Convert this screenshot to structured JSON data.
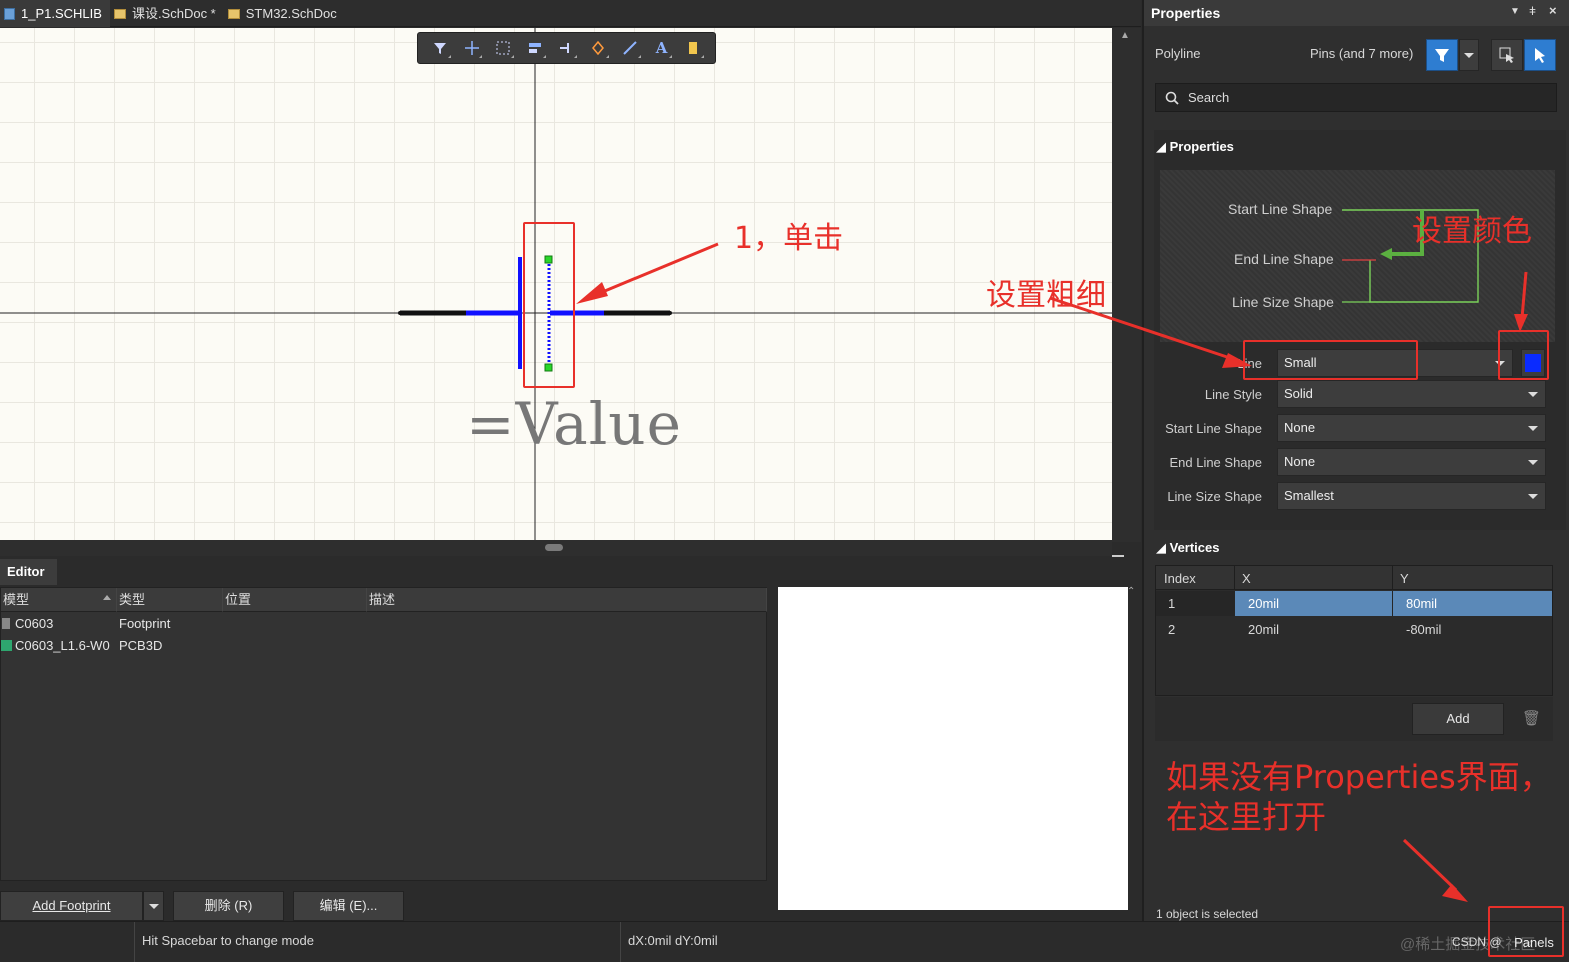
{
  "tabs": [
    {
      "label": "1_P1.SCHLIB",
      "icon": "schlib-icon",
      "active": true
    },
    {
      "label": "课设.SchDoc *",
      "icon": "schdoc-icon"
    },
    {
      "label": "STM32.SchDoc",
      "icon": "schdoc-icon"
    }
  ],
  "canvas": {
    "value_text": "=Value"
  },
  "editor": {
    "tab": "Editor",
    "columns": [
      "模型",
      "类型",
      "位置",
      "描述"
    ],
    "rows": [
      {
        "model": "C0603",
        "type": "Footprint",
        "location": "",
        "desc": ""
      },
      {
        "model": "C0603_L1.6-W0",
        "type": "PCB3D",
        "location": "",
        "desc": ""
      }
    ],
    "buttons": {
      "add_footprint": "Add Footprint",
      "delete": "删除 (R)",
      "edit": "编辑 (E)..."
    }
  },
  "status": {
    "hint": "Hit Spacebar to change mode",
    "delta": "dX:0mil dY:0mil"
  },
  "properties": {
    "title": "Properties",
    "object": "Polyline",
    "filter_summary": "Pins (and 7 more)",
    "search_placeholder": "Search",
    "section_properties": "Properties",
    "diagram_labels": [
      "Start Line Shape",
      "End Line Shape",
      "Line Size Shape"
    ],
    "fields": [
      {
        "label": "Line",
        "value": "Small"
      },
      {
        "label": "Line Style",
        "value": "Solid"
      },
      {
        "label": "Start Line Shape",
        "value": "None"
      },
      {
        "label": "End Line Shape",
        "value": "None"
      },
      {
        "label": "Line Size Shape",
        "value": "Smallest"
      }
    ],
    "line_color": "#0a2bff",
    "section_vertices": "Vertices",
    "vertices_columns": [
      "Index",
      "X",
      "Y"
    ],
    "vertices": [
      {
        "index": "1",
        "x": "20mil",
        "y": "80mil"
      },
      {
        "index": "2",
        "x": "20mil",
        "y": "-80mil"
      }
    ],
    "add_label": "Add",
    "selection_status": "1 object is selected",
    "panels_button": "Panels"
  },
  "annotations": {
    "click": "1，单击",
    "thickness": "设置粗细",
    "color": "设置颜色",
    "open_props": "如果没有Properties界面，",
    "open_props2": "在这里打开",
    "watermark": "@稀土掘金技术社区",
    "csdn": "CSDN @"
  },
  "colors": {
    "accent": "#2e7dd1",
    "annotation": "#e8302a",
    "pin": "#1010ff",
    "selected_row": "#5b89b8"
  }
}
